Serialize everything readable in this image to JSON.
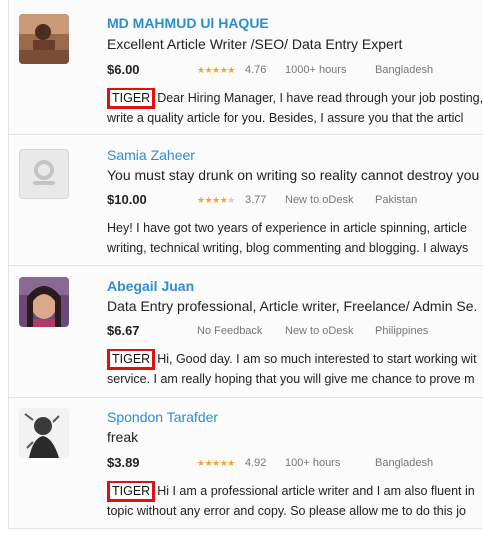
{
  "freelancers": [
    {
      "name": "MD MAHMUD Ul HAQUE",
      "title": "Excellent Article Writer /SEO/ Data Entry Expert",
      "rate": "$6.00",
      "stars": 4.5,
      "score": "4.76",
      "hours": "1000+ hours",
      "country": "Bangladesh",
      "tag": "TIGER",
      "cover_line1": "Dear Hiring Manager, I have read through your job posting,",
      "cover_line2": "write a quality article for you. Besides, I assure you that the articl"
    },
    {
      "name": "Samia Zaheer",
      "title": "You must stay drunk on writing so reality cannot destroy you",
      "rate": "$10.00",
      "stars": 3.5,
      "score": "3.77",
      "hours": "New to oDesk",
      "country": "Pakistan",
      "cover_line1": "Hey! I have got two years of experience in article spinning, article",
      "cover_line2": "writing, technical writing, blog commenting and blogging. I always"
    },
    {
      "name": "Abegail Juan",
      "title": "Data Entry professional, Article writer, Freelance/ Admin Se.",
      "rate": "$6.67",
      "feedback": "No Feedback",
      "hours": "New to oDesk",
      "country": "Philippines",
      "tag": "TIGER",
      "cover_line1": "Hi, Good day. I am so much interested to start working wit",
      "cover_line2": "service. I am really hoping that you will give me chance to prove m"
    },
    {
      "name": "Spondon Tarafder",
      "title": "freak",
      "rate": "$3.89",
      "stars": 5,
      "score": "4.92",
      "hours": "100+ hours",
      "country": "Bangladesh",
      "tag": "TIGER",
      "cover_line1": "Hi I am a professional article writer and I am also fluent in",
      "cover_line2": "topic without any error and copy. So please allow me to do this jo"
    }
  ],
  "colors": {
    "name_link": "#2b8fcf",
    "star": "#f4a623",
    "tag_border": "#e01010"
  }
}
